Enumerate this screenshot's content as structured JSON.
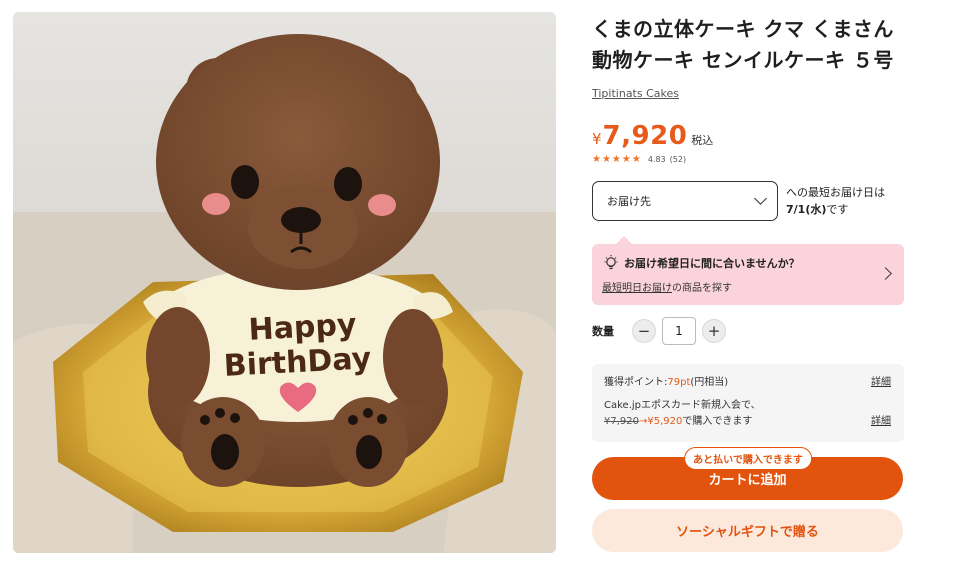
{
  "product": {
    "title": "くまの立体ケーキ クマ くまさん 動物ケーキ センイルケーキ ５号",
    "shop": "Tipitinats Cakes",
    "image_alt": "bear cake with Happy BirthDay shirt",
    "cake_text_line1": "Happy",
    "cake_text_line2": "BirthDay"
  },
  "price": {
    "currency": "¥",
    "amount": "7,920",
    "tax_label": "税込"
  },
  "rating": {
    "stars": "★★★★★",
    "value": "4.83",
    "count": "(52)",
    "score_out_of_5": 4.83
  },
  "delivery": {
    "select_label": "お届け先",
    "text_prefix": "への最短お届け日は",
    "date": "7/1(水)",
    "text_suffix": "です"
  },
  "notice": {
    "heading": "お届け希望日に間に合いませんか？",
    "link": "最短明日お届け",
    "suffix": "の商品を探す"
  },
  "quantity": {
    "label": "数量",
    "minus": "−",
    "value": "1",
    "plus": "+"
  },
  "points": {
    "label": "獲得ポイント:",
    "value": "79pt",
    "note": "(円相当)",
    "detail1": "詳細",
    "card_line": "Cake.jpエポスカード新規入会で、",
    "old_price": "¥7,920",
    "arrow": "→",
    "new_price": "¥5,920",
    "card_suffix": "で購入できます",
    "detail2": "詳細"
  },
  "actions": {
    "later_badge": "あと払いで購入できます",
    "cart": "カートに追加",
    "gift": "ソーシャルギフトで贈る"
  },
  "colors": {
    "accent": "#e2530e",
    "notice_bg": "#fbd3dd",
    "gift_bg": "#fde8dc"
  }
}
